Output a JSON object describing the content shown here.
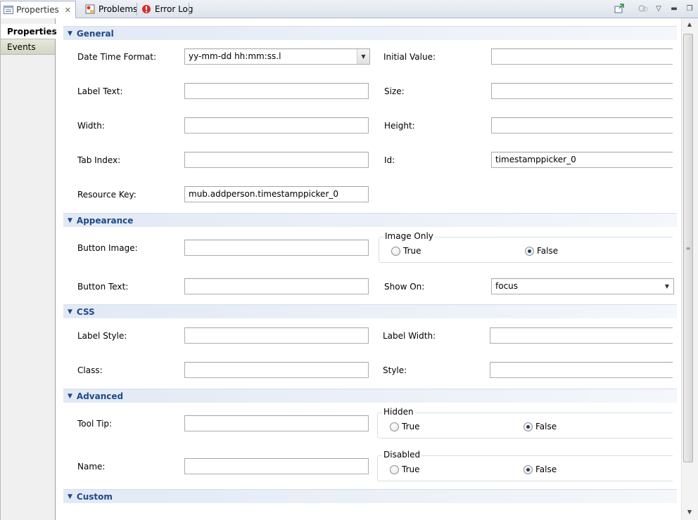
{
  "tabs": [
    {
      "label": "Properties",
      "icon": "properties-view-icon",
      "active": true
    },
    {
      "label": "Problems",
      "icon": "problems-icon",
      "active": false
    },
    {
      "label": "Error Log",
      "icon": "error-log-icon",
      "active": false
    }
  ],
  "side_tabs": {
    "properties": "Properties",
    "events": "Events"
  },
  "sections": {
    "general": "General",
    "appearance": "Appearance",
    "css": "CSS",
    "advanced": "Advanced",
    "custom": "Custom"
  },
  "general": {
    "date_time_format_label": "Date Time Format:",
    "date_time_format_value": "yy-mm-dd hh:mm:ss.l",
    "initial_value_label": "Initial Value:",
    "initial_value_value": "",
    "label_text_label": "Label Text:",
    "label_text_value": "",
    "size_label": "Size:",
    "size_value": "",
    "width_label": "Width:",
    "width_value": "",
    "height_label": "Height:",
    "height_value": "",
    "tab_index_label": "Tab Index:",
    "tab_index_value": "",
    "id_label": "Id:",
    "id_value": "timestamppicker_0",
    "resource_key_label": "Resource Key:",
    "resource_key_value": "mub.addperson.timestamppicker_0"
  },
  "appearance": {
    "button_image_label": "Button Image:",
    "button_image_value": "",
    "image_only_title": "Image Only",
    "true_label": "True",
    "false_label": "False",
    "image_only_selected": "False",
    "button_text_label": "Button Text:",
    "button_text_value": "",
    "show_on_label": "Show On:",
    "show_on_value": "focus"
  },
  "css": {
    "label_style_label": "Label Style:",
    "label_style_value": "",
    "label_width_label": "Label Width:",
    "label_width_value": "",
    "class_label": "Class:",
    "class_value": "",
    "style_label": "Style:",
    "style_value": ""
  },
  "advanced": {
    "tool_tip_label": "Tool Tip:",
    "tool_tip_value": "",
    "hidden_title": "Hidden",
    "hidden_selected": "False",
    "name_label": "Name:",
    "name_value": "",
    "disabled_title": "Disabled",
    "disabled_selected": "False",
    "true_label": "True",
    "false_label": "False"
  },
  "colors": {
    "section_text": "#1f4a8a",
    "section_bg": "#e2e9f5",
    "tab_bar": "#dde3ec"
  }
}
